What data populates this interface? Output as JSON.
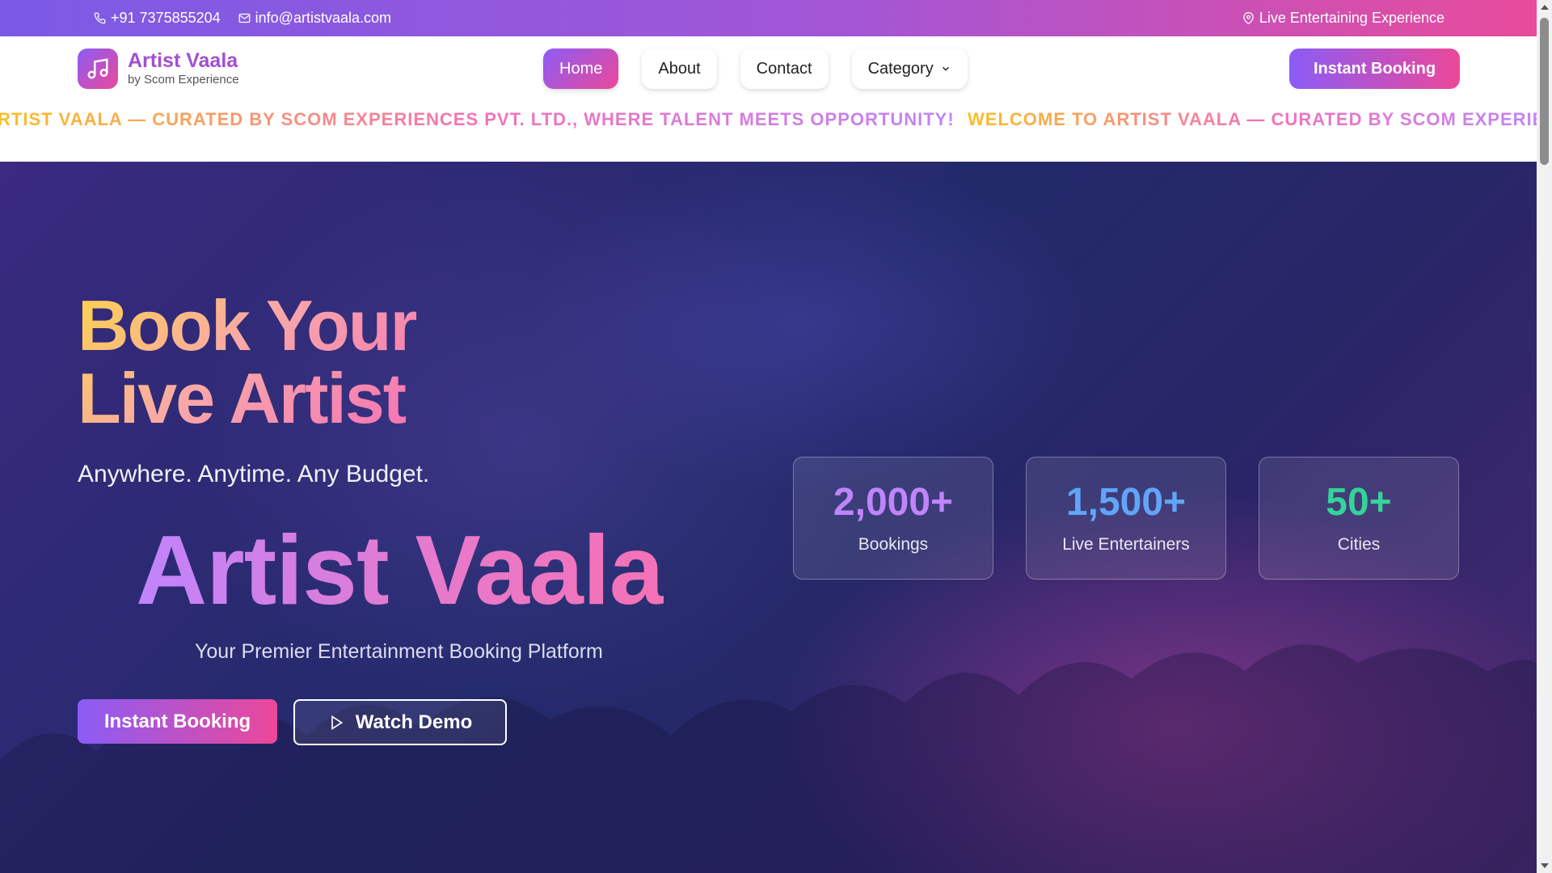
{
  "topbar": {
    "phone": "+91 7375855204",
    "email": "info@artistvaala.com",
    "tagline": "Live Entertaining Experience"
  },
  "header": {
    "brand": "Artist Vaala",
    "brand_sub": "by Scom Experience",
    "nav": [
      {
        "label": "Home",
        "active": true
      },
      {
        "label": "About"
      },
      {
        "label": "Contact"
      },
      {
        "label": "Category",
        "has_dropdown": true
      }
    ],
    "cta": "Instant Booking",
    "marquee_a": "RTIST VAALA — CURATED BY SCOM EXPERIENCES PVT. LTD., WHERE TALENT MEETS OPPORTUNITY!",
    "marquee_b": "WELCOME TO ARTIST VAALA — CURATED BY SCOM EXPERIE"
  },
  "hero": {
    "heading_line1": "Book Your",
    "heading_line2": "Live Artist",
    "tagline": "Anywhere. Anytime. Any Budget.",
    "brand_big": "Artist Vaala",
    "subtitle": "Your Premier Entertainment Booking Platform",
    "primary_cta": "Instant Booking",
    "secondary_cta": "Watch Demo",
    "stats": [
      {
        "value": "2,000+",
        "label": "Bookings",
        "color": "#c084fc"
      },
      {
        "value": "1,500+",
        "label": "Live Entertainers",
        "color": "#60a5fa"
      },
      {
        "value": "50+",
        "label": "Cities",
        "color": "#34d399"
      }
    ]
  },
  "icons": {
    "phone": "phone-icon",
    "email": "mail-icon",
    "location": "map-pin-icon",
    "logo": "music-note-icon",
    "dropdown": "chevron-down-icon",
    "play": "play-icon"
  }
}
